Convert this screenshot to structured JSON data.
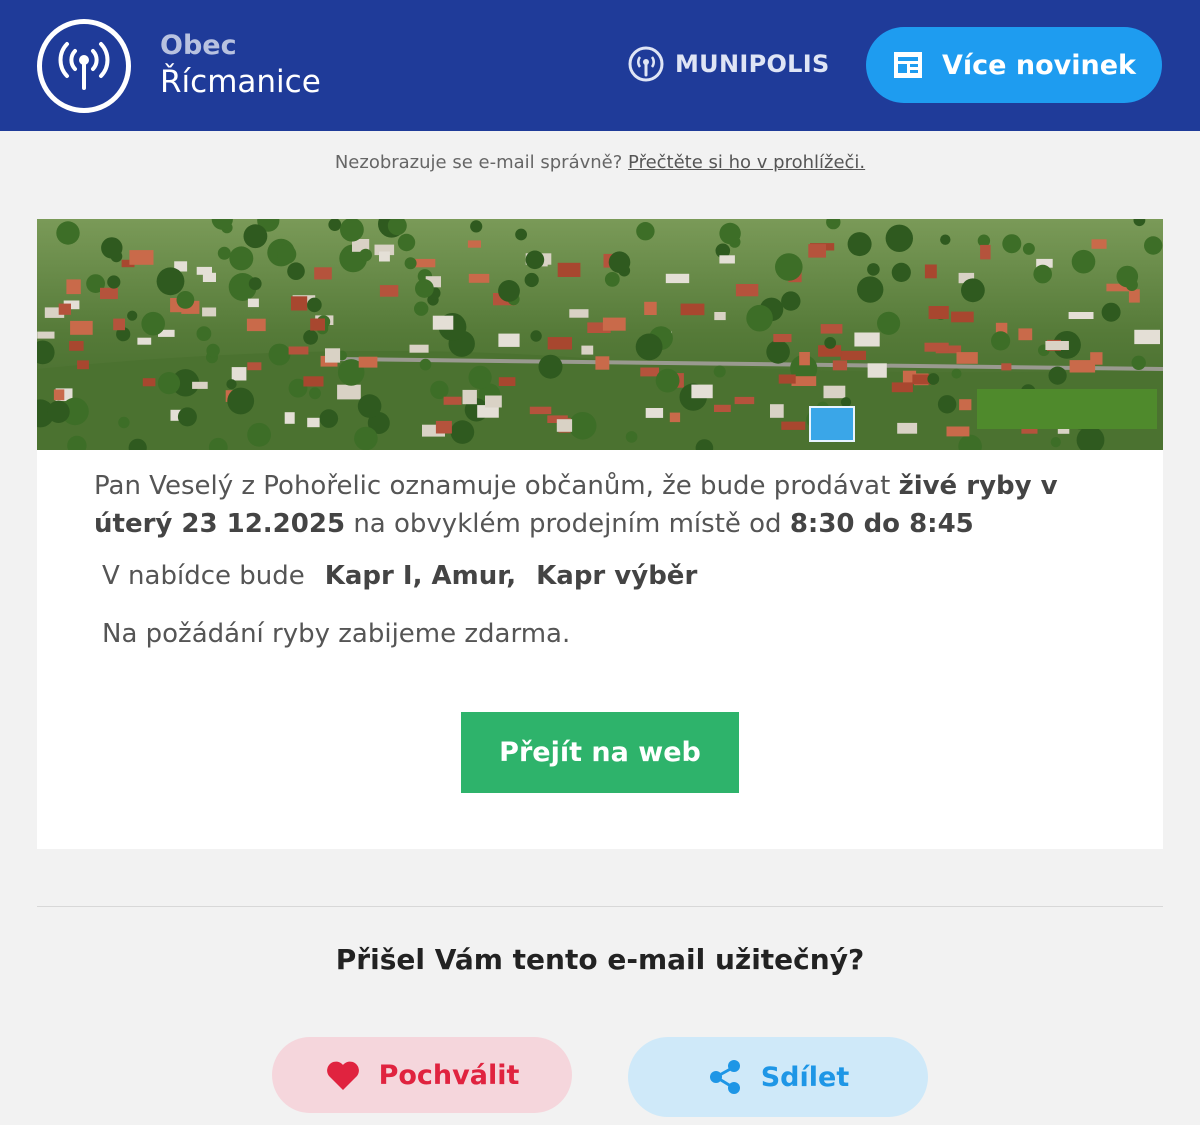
{
  "header": {
    "town_label": "Obec",
    "town_name": "Řícmanice",
    "brand": "MUNIPOLIS",
    "more_news_label": "Více novinek"
  },
  "notice": {
    "text": "Nezobrazuje se e-mail správně?",
    "link": "Přečtěte si ho v prohlížeči."
  },
  "message": {
    "part1": "Pan Veselý z Pohořelic oznamuje občanům, že bude prodávat ",
    "bold1": "živé ryby v úterý 23 12.2025",
    "part2": " na obvyklém prodejním místě od ",
    "bold2": "8:30 do 8:45"
  },
  "offer": {
    "label": "V nabídce bude",
    "items1": "Kapr I, Amur,",
    "items2": "Kapr výběr"
  },
  "kill_note": "Na požádání ryby zabijeme zdarma.",
  "web_button": "Přejít na web",
  "feedback": {
    "question": "Přišel Vám tento e-mail užitečný?",
    "praise_label": "Pochválit",
    "share_label": "Sdílet"
  },
  "colors": {
    "header_bg": "#1f3b99",
    "more_btn": "#1e9cf0",
    "web_btn": "#2eb36b",
    "praise": "#e0233f",
    "share": "#1e96e6"
  }
}
